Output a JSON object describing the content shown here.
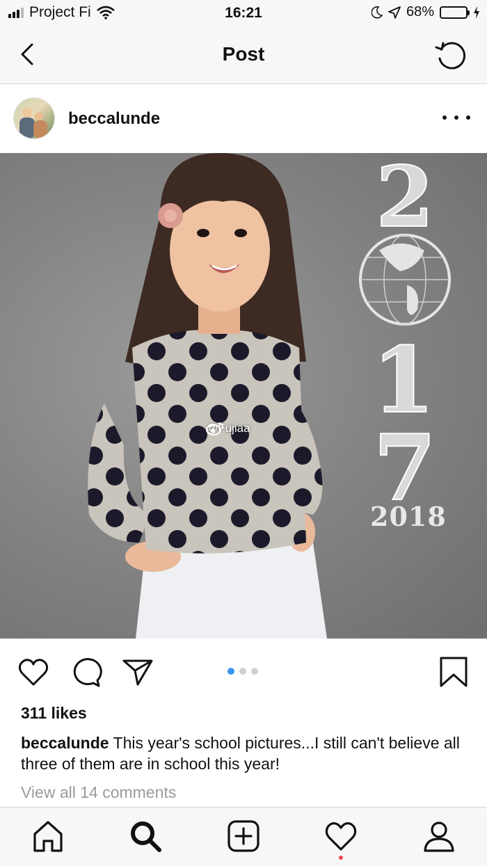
{
  "status": {
    "carrier": "Project Fi",
    "time": "16:21",
    "battery_percent": "68%",
    "battery_level": 0.68,
    "battery_color": "#4cd964"
  },
  "nav": {
    "title": "Post",
    "back_icon": "chevron-left-icon",
    "refresh_icon": "refresh-icon"
  },
  "post": {
    "username": "beccalunde",
    "photo": {
      "chalk_digits": [
        "2",
        "1",
        "7"
      ],
      "chalk_year": "2018",
      "watermark": "@Fujiaa"
    },
    "carousel": {
      "total": 3,
      "active": 1,
      "active_color": "#3897f0"
    },
    "likes": "311 likes",
    "caption_user": "beccalunde",
    "caption_text": " This year's school pictures...I still can't believe all three of them are in school this year!",
    "view_comments": "View all 14 comments"
  },
  "tabbar": {
    "items": [
      "home-icon",
      "search-icon",
      "add-post-icon",
      "activity-heart-icon",
      "profile-icon"
    ],
    "notification_color": "#ed4956"
  }
}
